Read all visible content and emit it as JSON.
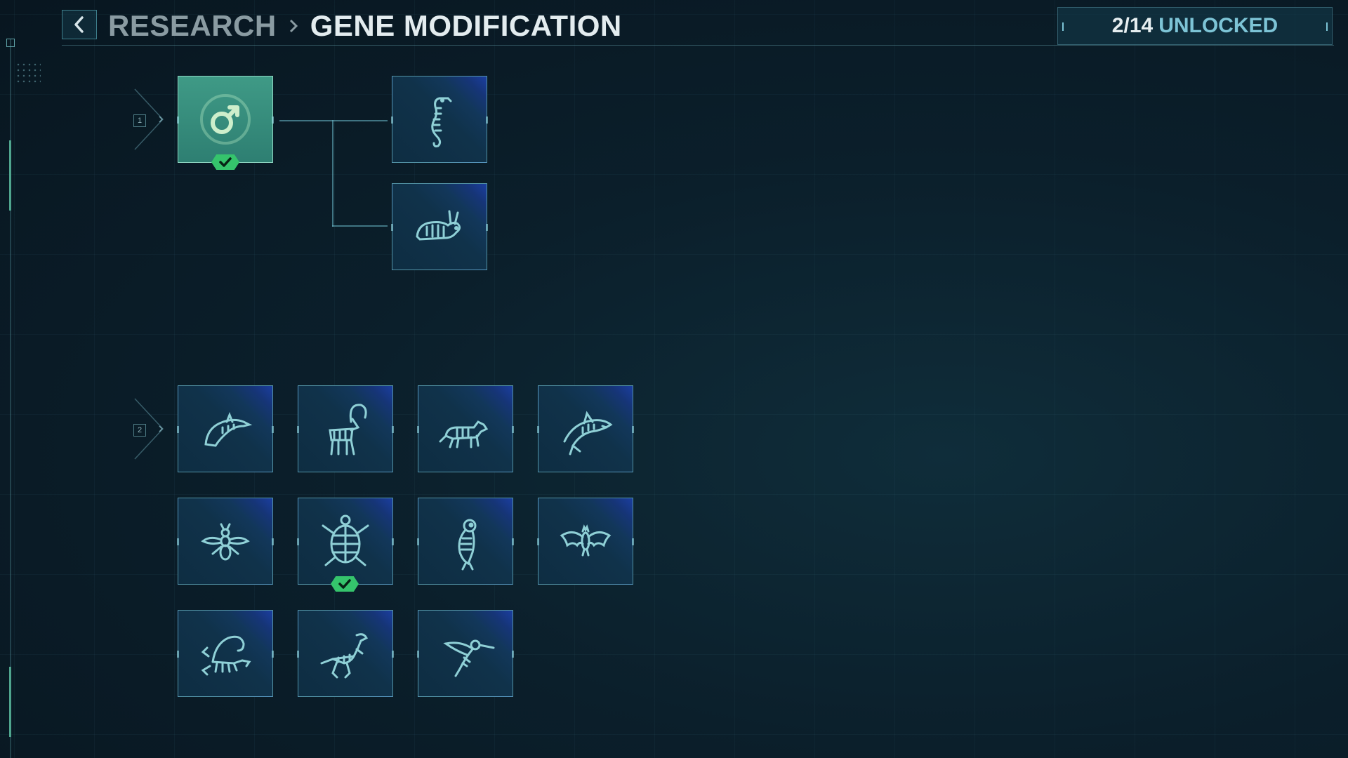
{
  "header": {
    "breadcrumb_root": "RESEARCH",
    "breadcrumb_current": "GENE MODIFICATION",
    "unlocked_count": "2/14",
    "unlocked_label": "UNLOCKED"
  },
  "tiers": [
    {
      "number": "1",
      "nodes": [
        {
          "icon": "male-symbol-icon",
          "unlocked": true
        },
        {
          "icon": "seahorse-icon",
          "unlocked": false
        },
        {
          "icon": "rabbit-icon",
          "unlocked": false
        }
      ]
    },
    {
      "number": "2",
      "nodes": [
        {
          "icon": "dolphin-icon",
          "unlocked": false
        },
        {
          "icon": "ibex-icon",
          "unlocked": false
        },
        {
          "icon": "wolf-icon",
          "unlocked": false
        },
        {
          "icon": "shark-icon",
          "unlocked": false
        },
        {
          "icon": "wasp-icon",
          "unlocked": false
        },
        {
          "icon": "turtle-icon",
          "unlocked": true
        },
        {
          "icon": "owl-icon",
          "unlocked": false
        },
        {
          "icon": "bat-icon",
          "unlocked": false
        },
        {
          "icon": "scorpion-icon",
          "unlocked": false
        },
        {
          "icon": "velociraptor-icon",
          "unlocked": false
        },
        {
          "icon": "hummingbird-icon",
          "unlocked": false
        }
      ]
    }
  ],
  "colors": {
    "accent": "#7dc4d6",
    "unlocked_badge": "#35c46c",
    "unlocked_node": "#3f9a86",
    "icon_stroke": "#8fd0d6"
  }
}
